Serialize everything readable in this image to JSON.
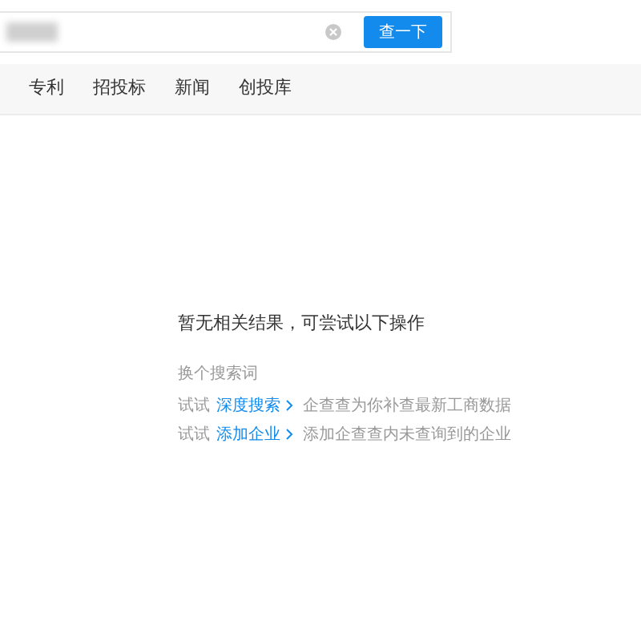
{
  "search": {
    "button": "查一下"
  },
  "tabs": [
    {
      "label": "专利"
    },
    {
      "label": "招投标"
    },
    {
      "label": "新闻"
    },
    {
      "label": "创投库"
    }
  ],
  "empty": {
    "title": "暂无相关结果，可尝试以下操作",
    "hint": "换个搜索词",
    "suggestions": [
      {
        "prefix": "试试",
        "link": "深度搜索",
        "text": "企查查为你补查最新工商数据"
      },
      {
        "prefix": "试试",
        "link": "添加企业",
        "text": "添加企查查内未查询到的企业"
      }
    ]
  }
}
